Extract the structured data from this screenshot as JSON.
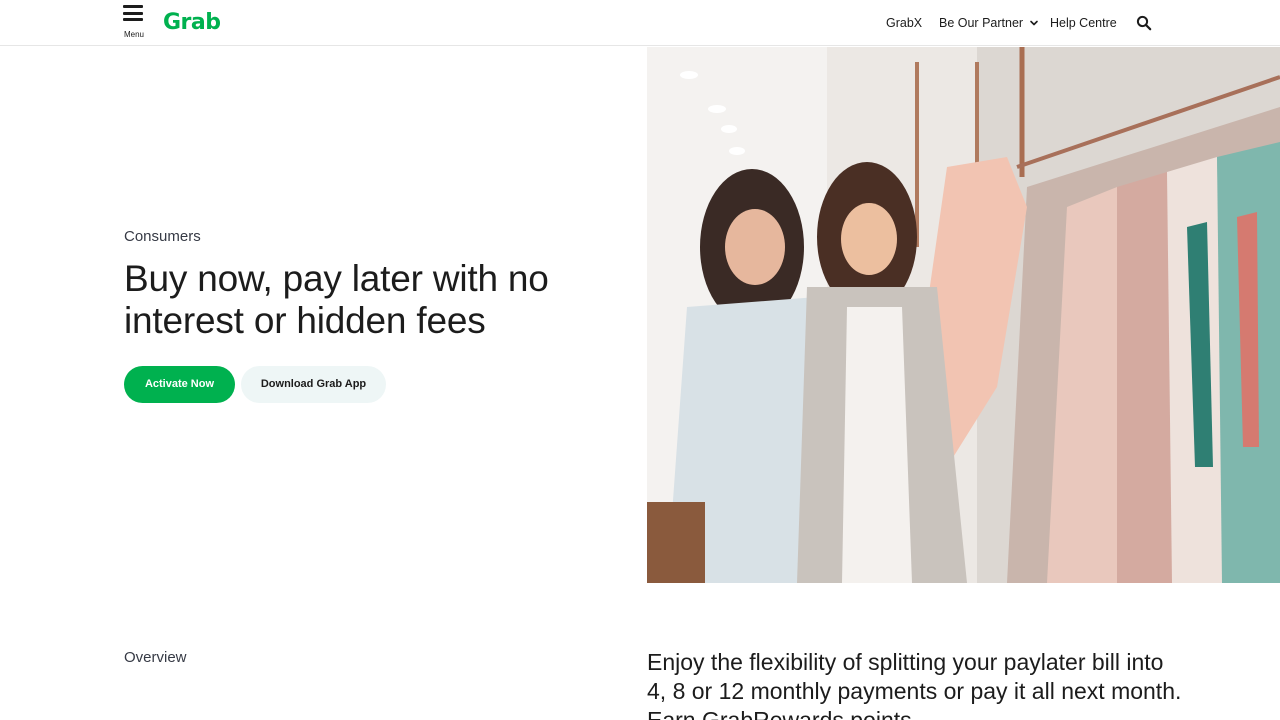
{
  "header": {
    "menu_label": "Menu",
    "logo_text": "Grab",
    "nav": {
      "grabx": "GrabX",
      "partner": "Be Our Partner",
      "help": "Help Centre"
    },
    "icons": {
      "menu": "hamburger-icon",
      "partner_dropdown": "chevron-down-icon",
      "search": "search-icon"
    }
  },
  "hero": {
    "eyebrow": "Consumers",
    "title": "Buy now, pay later with no interest or hidden fees",
    "primary_button": "Activate Now",
    "secondary_button": "Download Grab App",
    "image_description_icon": "photo-image"
  },
  "overview": {
    "label": "Overview",
    "text": "Enjoy the flexibility of splitting your paylater bill into 4, 8 or 12 monthly payments or pay it all next month. Earn GrabRewards points"
  },
  "colors": {
    "brand_green": "#00b14f",
    "secondary_button_bg": "#eef6f6",
    "text_dark": "#1c1c1c"
  }
}
